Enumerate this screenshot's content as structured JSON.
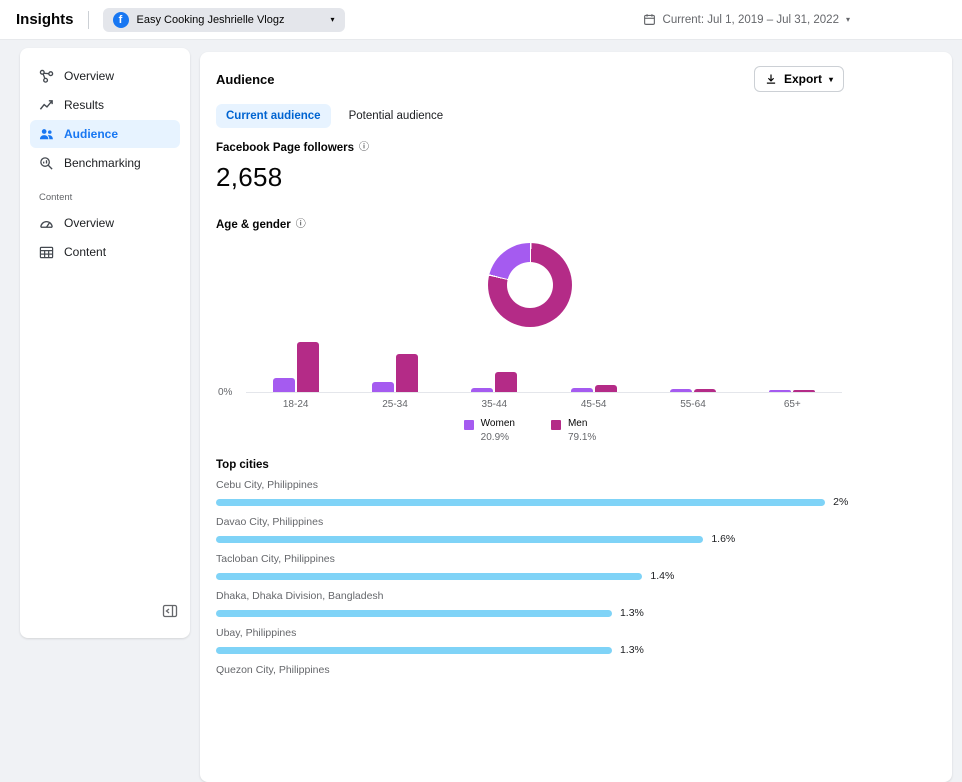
{
  "header": {
    "app_title": "Insights",
    "page_selector": {
      "page_name": "Easy Cooking Jeshrielle Vlogz",
      "logo_letter": "f"
    },
    "date_range": "Current: Jul 1, 2019 – Jul 31, 2022"
  },
  "sidebar": {
    "items": [
      {
        "label": "Overview"
      },
      {
        "label": "Results"
      },
      {
        "label": "Audience"
      },
      {
        "label": "Benchmarking"
      }
    ],
    "content_section_label": "Content",
    "content_items": [
      {
        "label": "Overview"
      },
      {
        "label": "Content"
      }
    ]
  },
  "main": {
    "title": "Audience",
    "export_label": "Export",
    "tabs": [
      {
        "label": "Current audience"
      },
      {
        "label": "Potential audience"
      }
    ],
    "followers_label": "Facebook Page followers",
    "followers_value": "2,658",
    "age_gender_label": "Age & gender",
    "top_cities_label": "Top cities"
  },
  "colors": {
    "accent_blue": "#1877f2",
    "selected_bg": "#e7f3ff",
    "tab_text": "#0064d1",
    "women": "#a55bf0",
    "men": "#b42b87",
    "city_bar": "#7fd3f7"
  },
  "chart_data": [
    {
      "type": "pie",
      "subtype": "donut",
      "title": "Age & gender",
      "slices": [
        {
          "label": "Women",
          "value": 20.9,
          "pct_label": "20.9%",
          "color": "#a55bf0"
        },
        {
          "label": "Men",
          "value": 79.1,
          "pct_label": "79.1%",
          "color": "#b42b87"
        }
      ],
      "legend_position": "bottom"
    },
    {
      "type": "bar",
      "title": "Age & gender",
      "categories": [
        "18-24",
        "25-34",
        "35-44",
        "45-54",
        "55-64",
        "65+"
      ],
      "series": [
        {
          "name": "Women",
          "color": "#a55bf0",
          "values": [
            9.2,
            6.6,
            2.6,
            2.6,
            2.0,
            1.3
          ]
        },
        {
          "name": "Men",
          "color": "#b42b87",
          "values": [
            32.9,
            25.0,
            13.2,
            4.6,
            2.0,
            1.3
          ]
        }
      ],
      "y_zero_label": "0%",
      "ylim": [
        0,
        35
      ],
      "grid": false
    },
    {
      "type": "bar",
      "orientation": "horizontal",
      "title": "Top cities",
      "max": 2,
      "items": [
        {
          "name": "Cebu City, Philippines",
          "value": 2,
          "value_label": "2%"
        },
        {
          "name": "Davao City, Philippines",
          "value": 1.6,
          "value_label": "1.6%"
        },
        {
          "name": "Tacloban City, Philippines",
          "value": 1.4,
          "value_label": "1.4%"
        },
        {
          "name": "Dhaka, Dhaka Division, Bangladesh",
          "value": 1.3,
          "value_label": "1.3%"
        },
        {
          "name": "Ubay, Philippines",
          "value": 1.3,
          "value_label": "1.3%"
        },
        {
          "name": "Quezon City, Philippines",
          "value": null,
          "value_label": ""
        }
      ]
    }
  ]
}
